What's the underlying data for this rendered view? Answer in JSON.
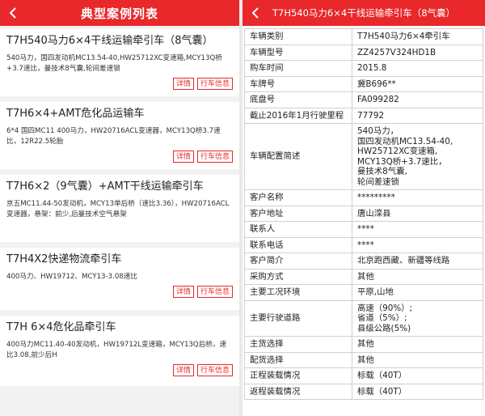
{
  "left": {
    "title": "典型案例列表",
    "cards": [
      {
        "title": "T7H540马力6×4干线运输牵引车（8气囊）",
        "desc": "540马力，国四发动机MC13.54-40,HW25712XC变速箱,MCY13Q桥+3.7速比，曼技术8气囊,轮间差速锁",
        "btn1": "详情",
        "btn2": "行车信息"
      },
      {
        "title": "T7H6×4+AMT危化品运输车",
        "desc": "6*4 国四MC11 400马力，HW20716ACL变速器，MCY13Q桥3.7速比，12R22.5轮胎",
        "btn1": "详情",
        "btn2": "行车信息"
      },
      {
        "title": "T7H6×2（9气囊）+AMT干线运输牵引车",
        "desc": "京五MC11.44-50发动机，MCY13单后桥（速比3.36），HW20716ACL变速器，悬架：前少,后曼技术空气悬架",
        "btn1": "详情",
        "btn2": "行车信息"
      },
      {
        "title": "T7H4X2快递物流牵引车",
        "desc": "400马力、HW19712、MCY13-3.08速比",
        "btn1": "详情",
        "btn2": "行车信息"
      },
      {
        "title": "T7H 6×4危化品牵引车",
        "desc": "400马力MC11.40-40发动机，HW19712L变速箱，MCY13Q后桥，速比3.08,前少后H",
        "btn1": "详情",
        "btn2": "行车信息"
      }
    ]
  },
  "right": {
    "title": "T7H540马力6×4干线运输牵引车（8气囊）",
    "rows": [
      {
        "k": "车辆类别",
        "v": "T7H540马力6×4牵引车"
      },
      {
        "k": "车辆型号",
        "v": "ZZ4257V324HD1B"
      },
      {
        "k": "购车时间",
        "v": "2015.8"
      },
      {
        "k": "车牌号",
        "v": "冀B696**"
      },
      {
        "k": "底盘号",
        "v": "FA099282"
      },
      {
        "k": "截止2016年1月行驶里程",
        "v": "77792"
      },
      {
        "k": "车辆配置简述",
        "v": "540马力，\n国四发动机MC13.54-40,\nHW25712XC变速箱,\nMCY13Q桥+3.7速比，\n曼技术8气囊,\n轮间差速锁"
      },
      {
        "k": "客户名称",
        "v": "*********"
      },
      {
        "k": "客户地址",
        "v": "唐山滦县"
      },
      {
        "k": "联系人",
        "v": "****"
      },
      {
        "k": "联系电话",
        "v": "****"
      },
      {
        "k": "客户简介",
        "v": "北京跑西藏、新疆等线路"
      },
      {
        "k": "采购方式",
        "v": "其他"
      },
      {
        "k": "主要工况环境",
        "v": "平原,山地"
      },
      {
        "k": "主要行驶道路",
        "v": "高速（90%）;\n省道（5%）;\n县级公路(5%)"
      },
      {
        "k": "主货选择",
        "v": "其他"
      },
      {
        "k": "配货选择",
        "v": "其他"
      },
      {
        "k": "正程装载情况",
        "v": "标载（40T）"
      },
      {
        "k": "返程装载情况",
        "v": "标载（40T）"
      }
    ]
  }
}
